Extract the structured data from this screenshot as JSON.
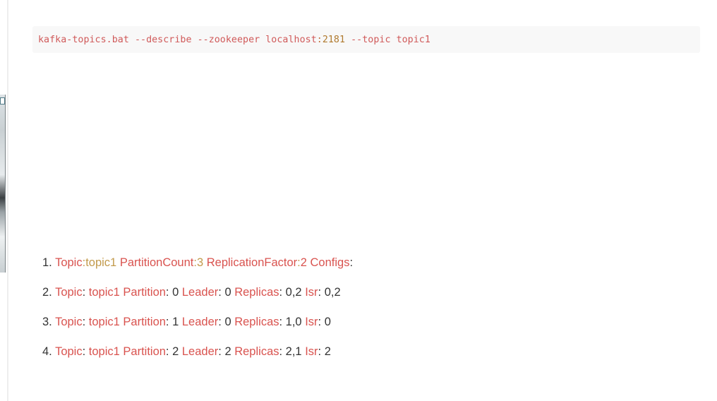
{
  "command": {
    "program": "kafka-topics.bat",
    "flag_describe": "--describe",
    "flag_zookeeper": "--zookeeper",
    "host": "localhost",
    "colon": ":",
    "port": "2181",
    "flag_topic": "--topic",
    "topic": "topic1"
  },
  "results": [
    {
      "num": "1.",
      "topic_key": "Topic",
      "topic_sep": ":",
      "topic_val": "topic1",
      "pc_key": "PartitionCount",
      "pc_sep": ":",
      "pc_val": "3",
      "rf_key": "ReplicationFactor",
      "rf_sep": ":",
      "rf_val": "2",
      "cfg_key": "Configs",
      "cfg_sep": ":"
    },
    {
      "num": "2.",
      "topic_key": "Topic",
      "topic_val": "topic1",
      "part_key": "Partition",
      "part_val": "0",
      "leader_key": "Leader",
      "leader_val": "0",
      "replicas_key": "Replicas",
      "replicas_val": "0,2",
      "isr_key": "Isr",
      "isr_val": "0,2"
    },
    {
      "num": "3.",
      "topic_key": "Topic",
      "topic_val": "topic1",
      "part_key": "Partition",
      "part_val": "1",
      "leader_key": "Leader",
      "leader_val": "0",
      "replicas_key": "Replicas",
      "replicas_val": "1,0",
      "isr_key": "Isr",
      "isr_val": "0"
    },
    {
      "num": "4.",
      "topic_key": "Topic",
      "topic_val": "topic1",
      "part_key": "Partition",
      "part_val": "2",
      "leader_key": "Leader",
      "leader_val": "2",
      "replicas_key": "Replicas",
      "replicas_val": "2,1",
      "isr_key": "Isr",
      "isr_val": "2"
    }
  ]
}
